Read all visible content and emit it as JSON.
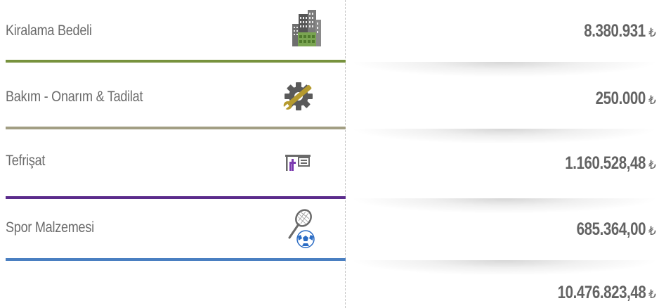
{
  "rows": [
    {
      "label": "Kiralama Bedeli",
      "value": "8.380.931",
      "currency": "₺",
      "icon": "building-icon",
      "line_color": "#77923d"
    },
    {
      "label": "Bakım - Onarım & Tadilat",
      "value": "250.000",
      "currency": "₺",
      "icon": "gear-wrench-icon",
      "line_color": "#a29e83"
    },
    {
      "label": "Tefrişat",
      "value": "1.160.528,48",
      "currency": "₺",
      "icon": "furniture-icon",
      "line_color": "#5b2c8c"
    },
    {
      "label": "Spor Malzemesi",
      "value": "685.364,00",
      "currency": "₺",
      "icon": "sports-equipment-icon",
      "line_color": "#4a7fc1"
    }
  ],
  "total": {
    "value": "10.476.823,48",
    "currency": "₺"
  }
}
